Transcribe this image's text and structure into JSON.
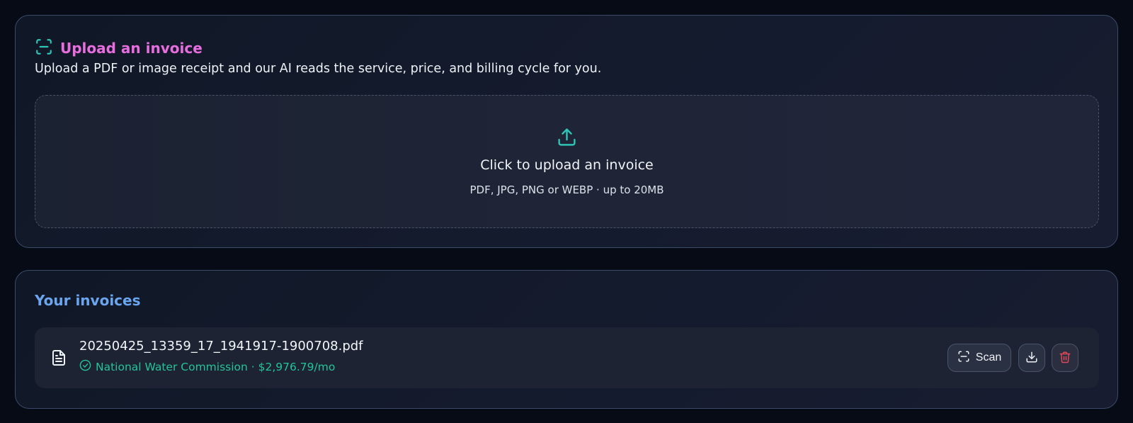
{
  "upload": {
    "title": "Upload an invoice",
    "description": "Upload a PDF or image receipt and our AI reads the service, price, and billing cycle for you.",
    "title_icon": "scan-icon",
    "dropzone": {
      "icon": "upload-icon",
      "title": "Click to upload an invoice",
      "subtitle": "PDF, JPG, PNG or WEBP · up to 20MB"
    }
  },
  "invoices": {
    "title": "Your invoices",
    "items": [
      {
        "file_icon": "file-text-icon",
        "filename": "20250425_13359_17_1941917-1900708.pdf",
        "status_icon": "check-circle-icon",
        "meta": "National Water Commission · $2,976.79/mo",
        "actions": {
          "scan_label": "Scan",
          "scan_icon": "scan-icon",
          "download_icon": "download-icon",
          "delete_icon": "trash-icon"
        }
      }
    ]
  },
  "colors": {
    "background": "#070b16",
    "upload_title": "#e86ee0",
    "list_title": "#6aa5ee",
    "accent_teal": "#2ec4b6",
    "success": "#23c49a",
    "danger": "#e0485a"
  }
}
